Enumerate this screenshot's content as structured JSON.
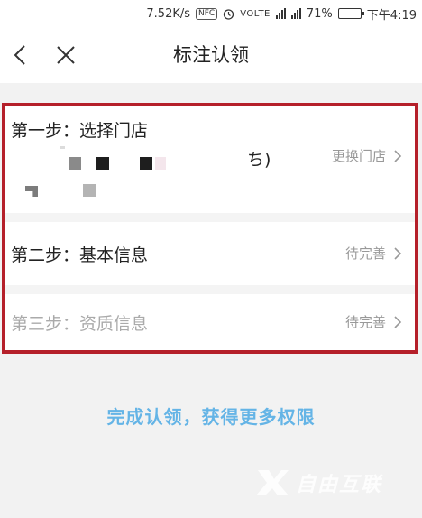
{
  "status_bar": {
    "net_speed": "7.52K/s",
    "nfc": "NFC",
    "volte": "VOLTE",
    "battery": "71%",
    "battery_level": 0.71,
    "time": "下午4:19"
  },
  "nav": {
    "title": "标注认领"
  },
  "steps": [
    {
      "title": "第一步：选择门店",
      "partial_text": "ち)",
      "action": "更换门店"
    },
    {
      "title": "第二步：基本信息",
      "action": "待完善"
    },
    {
      "title": "第三步：资质信息",
      "action": "待完善"
    }
  ],
  "cta": {
    "label": "完成认领，获得更多权限"
  },
  "watermark": {
    "text": "自由互联"
  },
  "colors": {
    "highlight_border": "#b5202a",
    "cta_text": "#64b4e6",
    "battery_fill": "#3cb54a"
  }
}
